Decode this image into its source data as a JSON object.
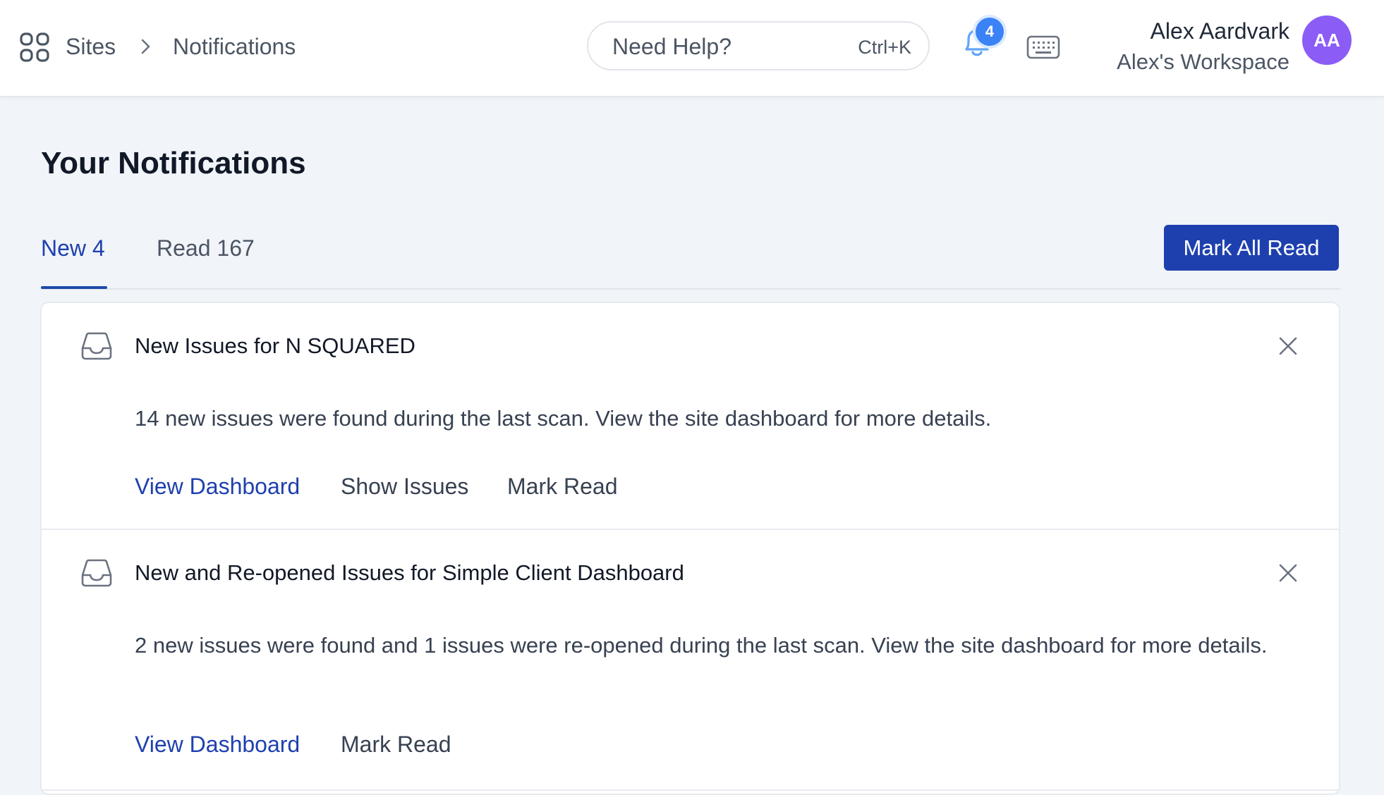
{
  "header": {
    "breadcrumb": {
      "root": "Sites",
      "current": "Notifications"
    },
    "help": {
      "label": "Need Help?",
      "shortcut": "Ctrl+K"
    },
    "notifications_badge": "4",
    "user": {
      "name": "Alex Aardvark",
      "workspace": "Alex's Workspace",
      "initials": "AA"
    }
  },
  "page": {
    "title": "Your Notifications",
    "tabs": [
      {
        "label": "New 4",
        "active": true
      },
      {
        "label": "Read 167",
        "active": false
      }
    ],
    "mark_all_read_label": "Mark All Read"
  },
  "notifications": [
    {
      "title": "New Issues for N SQUARED",
      "body": "14 new issues were found during the last scan. View the site dashboard for more details.",
      "actions": [
        "View Dashboard",
        "Show Issues",
        "Mark Read"
      ]
    },
    {
      "title": "New and Re-opened Issues for Simple Client Dashboard",
      "body": "2 new issues were found and 1 issues were re-opened during the last scan. View the site dashboard for more details.",
      "actions": [
        "View Dashboard",
        "Mark Read"
      ]
    }
  ],
  "colors": {
    "primary": "#1e40af",
    "badge": "#3b82f6",
    "avatar": "#8b5cf6",
    "background": "#f1f4f8"
  },
  "icons": [
    "grid-icon",
    "chevron-right-icon",
    "bell-icon",
    "keyboard-icon",
    "inbox-icon",
    "close-icon"
  ]
}
